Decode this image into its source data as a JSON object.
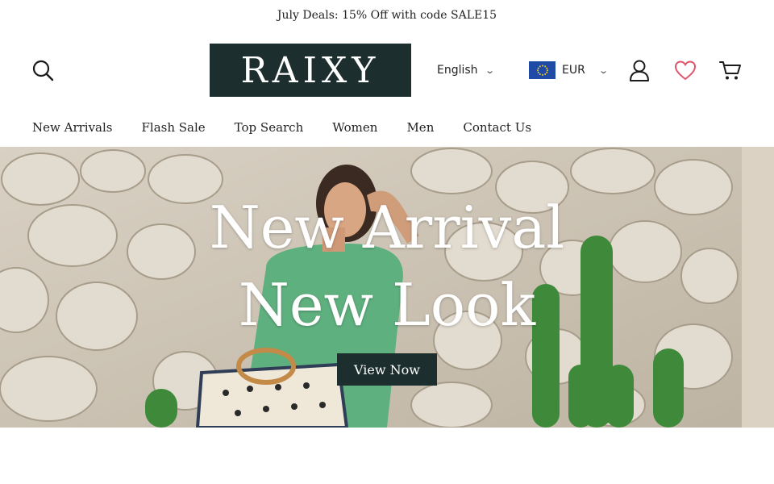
{
  "announcement": "July Deals: 15% Off with code SALE15",
  "header": {
    "logo_text": "RAIXY",
    "language": "English",
    "currency": "EUR",
    "icons": [
      "search-icon",
      "eu-flag-icon",
      "account-icon",
      "heart-icon",
      "cart-icon"
    ]
  },
  "nav": {
    "items": [
      "New Arrivals",
      "Flash Sale",
      "Top Search",
      "Women",
      "Men",
      "Contact Us"
    ]
  },
  "hero": {
    "line1": "New Arrival",
    "line2": "New Look",
    "cta": "View Now"
  },
  "colors": {
    "brand_dark": "#1c2f2e",
    "heart": "#e0546a",
    "flag_blue": "#1f4aa6",
    "flag_stars": "#f5cf2a"
  }
}
